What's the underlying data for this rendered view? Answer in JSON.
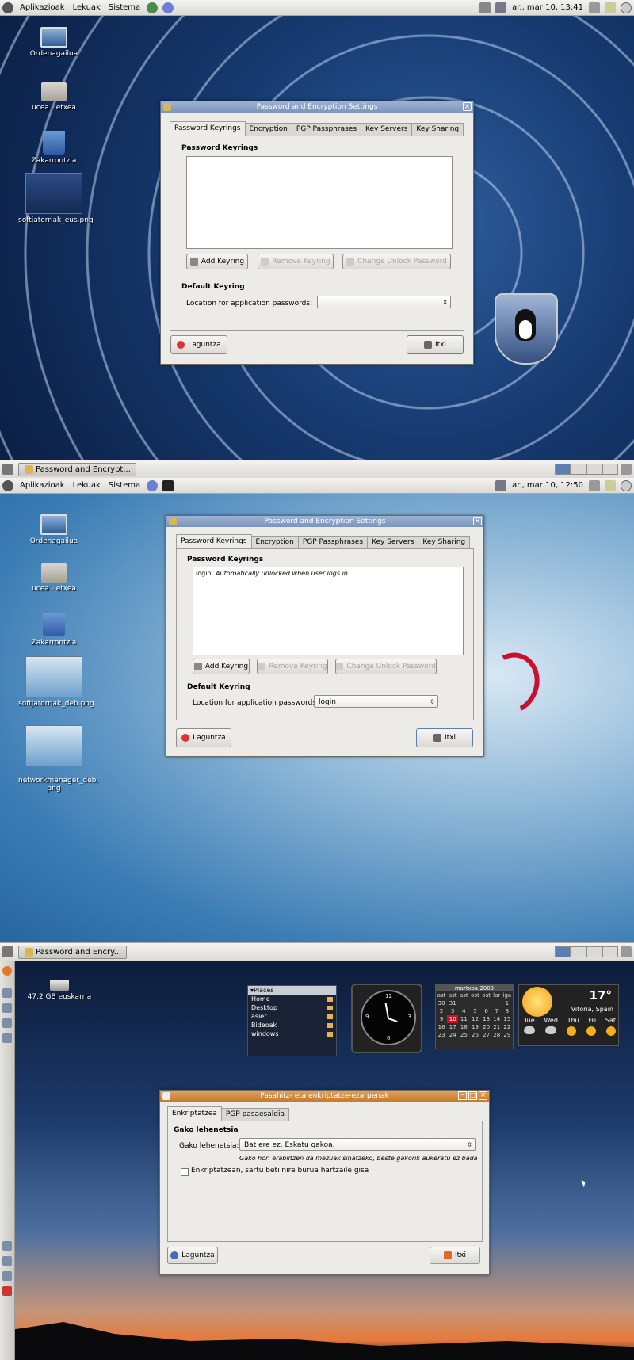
{
  "shot1": {
    "top_panel": {
      "menus": [
        "Aplikazioak",
        "Lekuak",
        "Sistema"
      ],
      "clock": "ar., mar 10, 13:41"
    },
    "desktop_icons": [
      "Ordenagailua",
      "ucea - etxea",
      "Zakarrontzia",
      "softjatorriak_eus.png"
    ],
    "window": {
      "title": "Password and Encryption Settings",
      "tabs": [
        "Password Keyrings",
        "Encryption",
        "PGP Passphrases",
        "Key Servers",
        "Key Sharing"
      ],
      "section_keyrings": "Password Keyrings",
      "keyrings": [],
      "add_keyring": "Add Keyring",
      "remove_keyring": "Remove Keyring",
      "change_unlock": "Change Unlock Password",
      "section_default": "Default Keyring",
      "location_label": "Location for application passwords:",
      "location_value": "",
      "help": "Laguntza",
      "close": "Itxi"
    },
    "bottom_panel": {
      "task": "Password and Encrypt..."
    }
  },
  "shot2": {
    "top_panel": {
      "menus": [
        "Aplikazioak",
        "Lekuak",
        "Sistema"
      ],
      "clock": "ar., mar 10, 12:50"
    },
    "desktop_icons": [
      "Ordenagailua",
      "ucea - etxea",
      "Zakarrontzia",
      "softjatorriak_deb.png",
      "networkmanager_deb.\npng"
    ],
    "window": {
      "title": "Password and Encryption Settings",
      "tabs": [
        "Password Keyrings",
        "Encryption",
        "PGP Passphrases",
        "Key Servers",
        "Key Sharing"
      ],
      "section_keyrings": "Password Keyrings",
      "keyring_name": "login",
      "keyring_desc": "Automatically unlocked when user logs in.",
      "add_keyring": "Add Keyring",
      "remove_keyring": "Remove Keyring",
      "change_unlock": "Change Unlock Password",
      "section_default": "Default Keyring",
      "location_label": "Location for application passwords:",
      "location_value": "login",
      "help": "Laguntza",
      "close": "Itxi"
    },
    "bottom_panel": {
      "task": "Password and Encry..."
    }
  },
  "shot3": {
    "drive_icon": "47.2 GB euskarria",
    "places": {
      "title": "▾Places",
      "items": [
        "Home",
        "Desktop",
        "asier",
        "Bideoak",
        "windows"
      ]
    },
    "clock_numbers": [
      "12",
      "3",
      "6",
      "9"
    ],
    "calendar": {
      "title": "martxoa 2009",
      "days": [
        "ast",
        "ast",
        "ast",
        "ost",
        "ost",
        "lar",
        "iga"
      ],
      "weeks": [
        [
          "30",
          "31",
          "",
          "",
          "",
          "",
          "1"
        ],
        [
          "2",
          "3",
          "4",
          "5",
          "6",
          "7",
          "8"
        ],
        [
          "9",
          "10",
          "11",
          "12",
          "13",
          "14",
          "15"
        ],
        [
          "16",
          "17",
          "18",
          "19",
          "20",
          "21",
          "22"
        ],
        [
          "23",
          "24",
          "25",
          "26",
          "27",
          "28",
          "29"
        ]
      ],
      "today": "10"
    },
    "weather": {
      "temp": "17°",
      "location": "Vitoria, Spain",
      "days": [
        "Tue",
        "Wed",
        "Thu",
        "Fri",
        "Sat"
      ]
    },
    "window": {
      "title": "Pasahitz- eta enkriptatze-ezarpenak",
      "tabs": [
        "Enkriptatzea",
        "PGP pasaesaldia"
      ],
      "section": "Gako lehenetsia",
      "key_label": "Gako lehenetsia:",
      "key_value": "Bat ere ez. Eskatu gakoa.",
      "hint": "Gako hori erabiltzen da mezuak sinatzeko, beste gakorik aukeratu ez bada",
      "checkbox": "Enkriptatzean, sartu beti nire burua hartzaile gisa",
      "help": "Laguntza",
      "close": "Itxi"
    }
  },
  "colors": {
    "titlebar_blue": "#8aa2c8",
    "titlebar_orange": "#d68c3f",
    "panel": "#e6e4df"
  }
}
